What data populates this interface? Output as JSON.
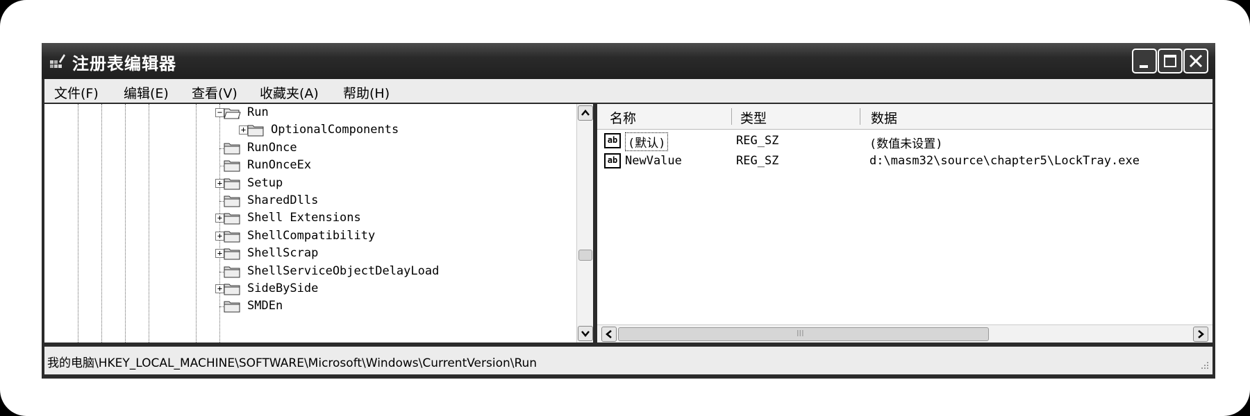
{
  "window": {
    "title": "注册表编辑器"
  },
  "menu": [
    "文件(F)",
    "编辑(E)",
    "查看(V)",
    "收藏夹(A)",
    "帮助(H)"
  ],
  "tree": [
    {
      "label": "Run",
      "expander": "−",
      "open": true
    },
    {
      "label": "OptionalComponents",
      "expander": "+",
      "open": false
    },
    {
      "label": "RunOnce",
      "expander": "",
      "open": false
    },
    {
      "label": "RunOnceEx",
      "expander": "",
      "open": false
    },
    {
      "label": "Setup",
      "expander": "+",
      "open": false
    },
    {
      "label": "SharedDlls",
      "expander": "",
      "open": false
    },
    {
      "label": "Shell Extensions",
      "expander": "+",
      "open": false
    },
    {
      "label": "ShellCompatibility",
      "expander": "+",
      "open": false
    },
    {
      "label": "ShellScrap",
      "expander": "+",
      "open": false
    },
    {
      "label": "ShellServiceObjectDelayLoad",
      "expander": "",
      "open": false
    },
    {
      "label": "SideBySide",
      "expander": "+",
      "open": false
    },
    {
      "label": "SMDEn",
      "expander": "",
      "open": false
    }
  ],
  "list": {
    "columns": [
      "名称",
      "类型",
      "数据"
    ],
    "rows": [
      {
        "name": "(默认)",
        "type": "REG_SZ",
        "data": "(数值未设置)",
        "icon": "ab"
      },
      {
        "name": "NewValue",
        "type": "REG_SZ",
        "data": "d:\\masm32\\source\\chapter5\\LockTray.exe",
        "icon": "ab"
      }
    ]
  },
  "status": {
    "path": "我的电脑\\HKEY_LOCAL_MACHINE\\SOFTWARE\\Microsoft\\Windows\\CurrentVersion\\Run"
  },
  "scrollbars": {
    "horizontal_indicator": "III"
  }
}
